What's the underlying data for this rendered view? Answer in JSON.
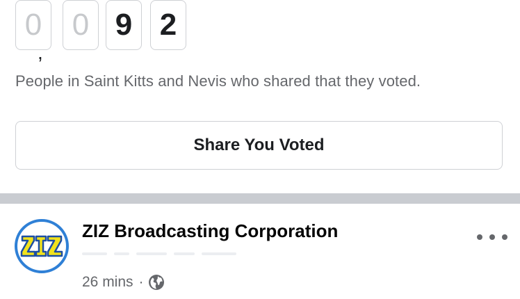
{
  "counter": {
    "digits": [
      {
        "value": "0",
        "style": "dim"
      },
      {
        "value": "0",
        "style": "dim"
      },
      {
        "value": "9",
        "style": "bold"
      },
      {
        "value": "2",
        "style": "bold"
      }
    ],
    "separator": ",",
    "caption": "People in Saint Kitts and Nevis who shared that they voted."
  },
  "share_button": {
    "label": "Share You Voted"
  },
  "post": {
    "page_name": "ZIZ Broadcasting Corporation",
    "avatar_logo_text": "ZIZ",
    "time": "26 mins",
    "meta_separator": "·",
    "audience_icon": "globe-icon",
    "more_icon": "more-horizontal-icon"
  },
  "colors": {
    "brand_ring": "#2f80d6",
    "logo_yellow": "#f2e21c",
    "logo_blue": "#1d4fa3",
    "separator": "#c9ccd1",
    "secondary_text": "#65676b"
  }
}
